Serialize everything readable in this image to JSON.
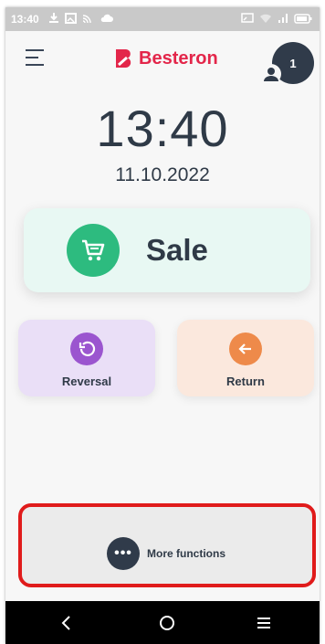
{
  "status_bar": {
    "time": "13:40",
    "icons_left": [
      "download-icon",
      "image-icon",
      "cast-icon",
      "cloud-icon"
    ],
    "icons_right": [
      "screen-cast-icon",
      "wifi-icon",
      "signal-icon",
      "battery-icon"
    ]
  },
  "header": {
    "menu_icon": "hamburger-menu-icon",
    "logo_text": "Besteron",
    "avatar_count": "1",
    "brand_color": "#e3264a"
  },
  "clock": {
    "time": "13:40",
    "date": "11.10.2022"
  },
  "actions": {
    "sale": {
      "label": "Sale",
      "icon": "cart-icon",
      "color": "#2dbb7f"
    },
    "reversal": {
      "label": "Reversal",
      "icon": "undo-icon",
      "color": "#9b55cf"
    },
    "return": {
      "label": "Return",
      "icon": "arrow-left-icon",
      "color": "#ee8a4a"
    }
  },
  "more_functions": {
    "label": "More functions",
    "icon_text": "•••",
    "highlight_color": "#e01b1b"
  },
  "navbar": {
    "back_icon": "back-chevron-icon",
    "home_icon": "home-circle-icon",
    "menu_icon": "recent-menu-icon"
  }
}
